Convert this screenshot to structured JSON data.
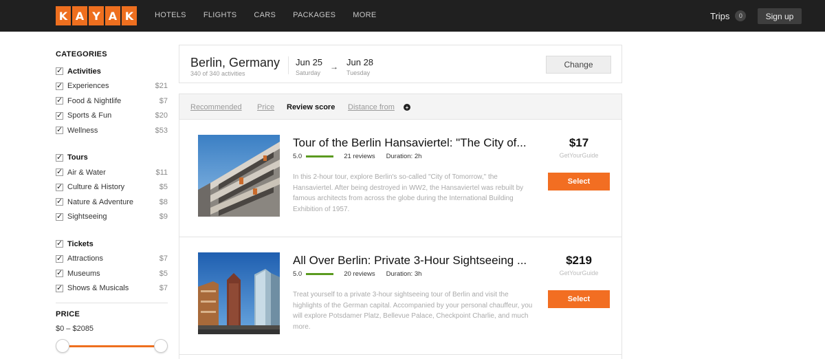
{
  "brand": {
    "logo_letters": [
      "K",
      "A",
      "Y",
      "A",
      "K"
    ],
    "accent": "#ee6f1f"
  },
  "nav": {
    "items": [
      "HOTELS",
      "FLIGHTS",
      "CARS",
      "PACKAGES",
      "MORE"
    ]
  },
  "header": {
    "trips_label": "Trips",
    "trips_count": "0",
    "signup_label": "Sign up"
  },
  "sidebar": {
    "categories_title": "CATEGORIES",
    "groups": [
      {
        "name": "Activities",
        "items": [
          {
            "label": "Experiences",
            "price": "$21"
          },
          {
            "label": "Food & Nightlife",
            "price": "$7"
          },
          {
            "label": "Sports & Fun",
            "price": "$20"
          },
          {
            "label": "Wellness",
            "price": "$53"
          }
        ]
      },
      {
        "name": "Tours",
        "items": [
          {
            "label": "Air & Water",
            "price": "$11"
          },
          {
            "label": "Culture & History",
            "price": "$5"
          },
          {
            "label": "Nature & Adventure",
            "price": "$8"
          },
          {
            "label": "Sightseeing",
            "price": "$9"
          }
        ]
      },
      {
        "name": "Tickets",
        "items": [
          {
            "label": "Attractions",
            "price": "$7"
          },
          {
            "label": "Museums",
            "price": "$5"
          },
          {
            "label": "Shows & Musicals",
            "price": "$7"
          }
        ]
      }
    ],
    "price_title": "PRICE",
    "price_range": "$0 – $2085"
  },
  "search": {
    "city": "Berlin, Germany",
    "count_text": "340 of 340 activities",
    "start_date": "Jun 25",
    "start_day": "Saturday",
    "end_date": "Jun 28",
    "end_day": "Tuesday",
    "change_label": "Change"
  },
  "sort": {
    "options": [
      "Recommended",
      "Price",
      "Review score",
      "Distance from"
    ],
    "active": "Review score"
  },
  "results": [
    {
      "title": "Tour of the Berlin Hansaviertel: \"The City of...",
      "rating": "5.0",
      "reviews": "21 reviews",
      "duration": "Duration: 2h",
      "description": "In this 2-hour tour, explore Berlin's so-called \"City of Tomorrow,\" the Hansaviertel. After being destroyed in WW2, the Hansaviertel was rebuilt by famous architects from across the globe during the International Building Exhibition of 1957.",
      "price": "$17",
      "provider": "GetYourGuide",
      "select_label": "Select"
    },
    {
      "title": "All Over Berlin: Private 3-Hour Sightseeing ...",
      "rating": "5.0",
      "reviews": "20 reviews",
      "duration": "Duration: 3h",
      "description": "Treat yourself to a private 3-hour sightseeing tour of Berlin and visit the highlights of the German capital. Accompanied by your personal chauffeur, you will explore Potsdamer Platz, Bellevue Palace, Checkpoint Charlie, and much more.",
      "price": "$219",
      "provider": "GetYourGuide",
      "select_label": "Select"
    }
  ]
}
